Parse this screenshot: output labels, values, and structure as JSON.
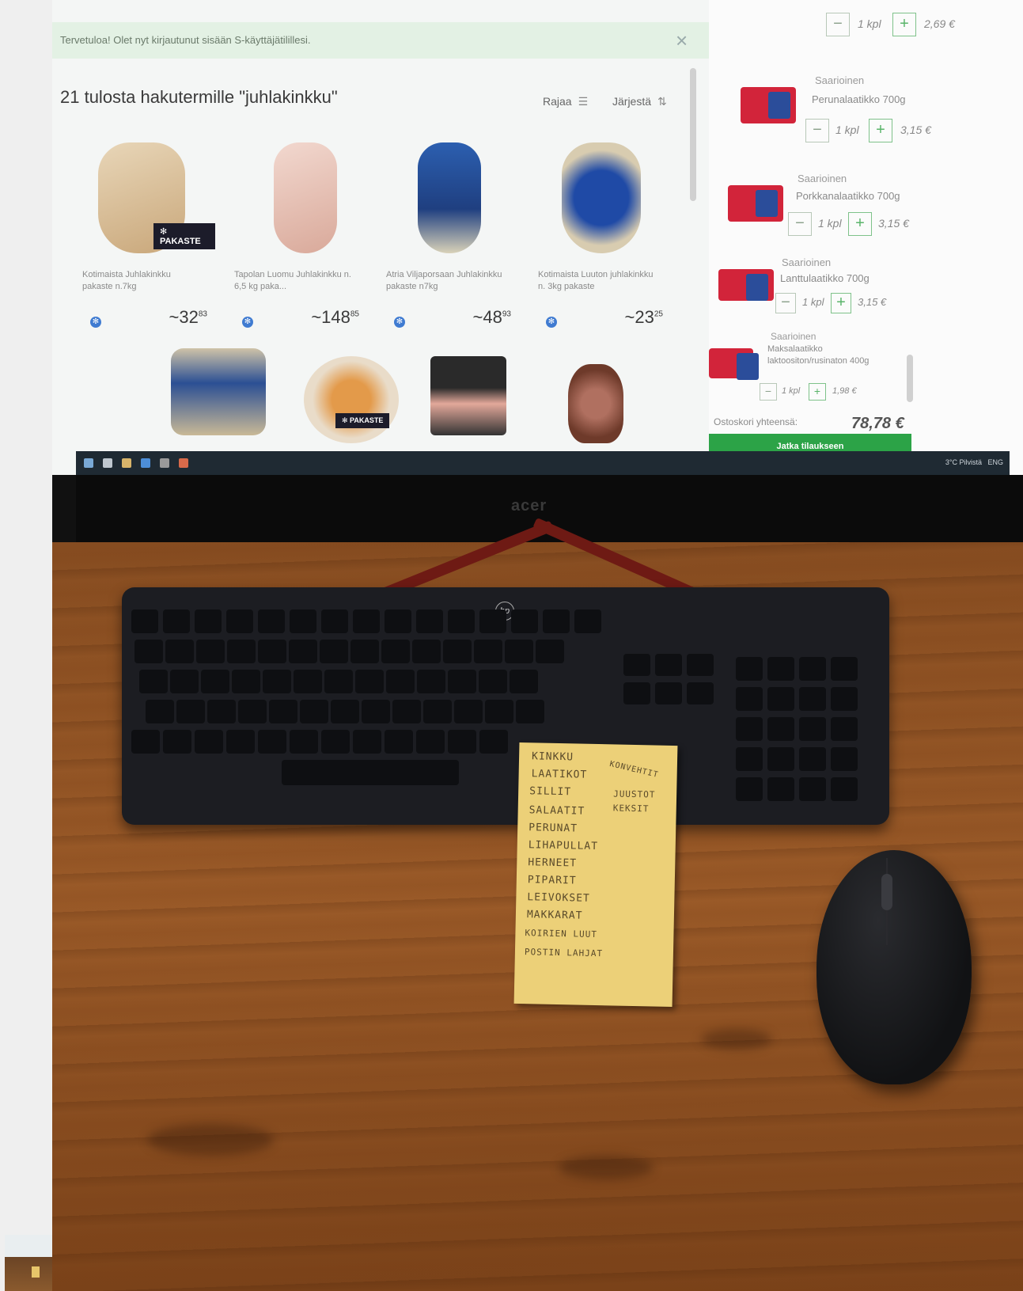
{
  "notice": {
    "text": "Tervetuloa! Olet nyt kirjautunut sisään S-käyttäjätilillesi."
  },
  "results": {
    "title": "21 tulosta hakutermille \"juhlakinkku\"",
    "filter_label": "Rajaa",
    "sort_label": "Järjestä"
  },
  "products": [
    {
      "name": "Kotimaista Juhlakinkku pakaste n.7kg",
      "price_main": "~32",
      "price_cents": "83",
      "badge": "PAKASTE"
    },
    {
      "name": "Tapolan Luomu Juhlakinkku n. 6,5 kg paka...",
      "price_main": "~148",
      "price_cents": "85",
      "badge": ""
    },
    {
      "name": "Atria Viljaporsaan Juhlakinkku pakaste n7kg",
      "price_main": "~48",
      "price_cents": "93",
      "badge": ""
    },
    {
      "name": "Kotimaista Luuton juhlakinkku n. 3kg pakaste",
      "price_main": "~23",
      "price_cents": "25",
      "badge": ""
    }
  ],
  "row2_badge": "PAKASTE",
  "cart": {
    "top_qty": "1 kpl",
    "top_price": "2,69 €",
    "items": [
      {
        "brand": "Saarioinen",
        "name": "Perunalaatikko 700g",
        "qty": "1 kpl",
        "price": "3,15 €"
      },
      {
        "brand": "Saarioinen",
        "name": "Porkkanalaatikko 700g",
        "qty": "1 kpl",
        "price": "3,15 €"
      },
      {
        "brand": "Saarioinen",
        "name": "Lanttulaatikko 700g",
        "qty": "1 kpl",
        "price": "3,15 €"
      },
      {
        "brand": "Saarioinen",
        "name": "Maksalaatikko laktoositon/rusinaton 400g",
        "qty": "1 kpl",
        "price": "1,98 €"
      }
    ],
    "total_label": "Ostoskori yhteensä:",
    "total": "78,78 €",
    "checkout_label": "Jatka tilaukseen"
  },
  "monitor_brand": "acer",
  "keyboard_brand": "hp",
  "tray": {
    "weather": "3°C Pilvistä",
    "lang": "ENG"
  },
  "note": {
    "lines": [
      "KINKKU",
      "LAATIKOT",
      "SILLIT",
      "SALAATIT",
      "PERUNAT",
      "LIHAPULLAT",
      "HERNEET",
      "PIPARIT",
      "LEIVOKSET",
      "MAKKARAT",
      "KOIRIEN LUUT",
      "POSTIN LAHJAT"
    ],
    "side_lines": [
      "KONVEHTIT",
      "JUUSTOT",
      "KEKSIT"
    ]
  },
  "colors": {
    "accent_green": "#2ca347",
    "sale_red": "#d2243a"
  }
}
